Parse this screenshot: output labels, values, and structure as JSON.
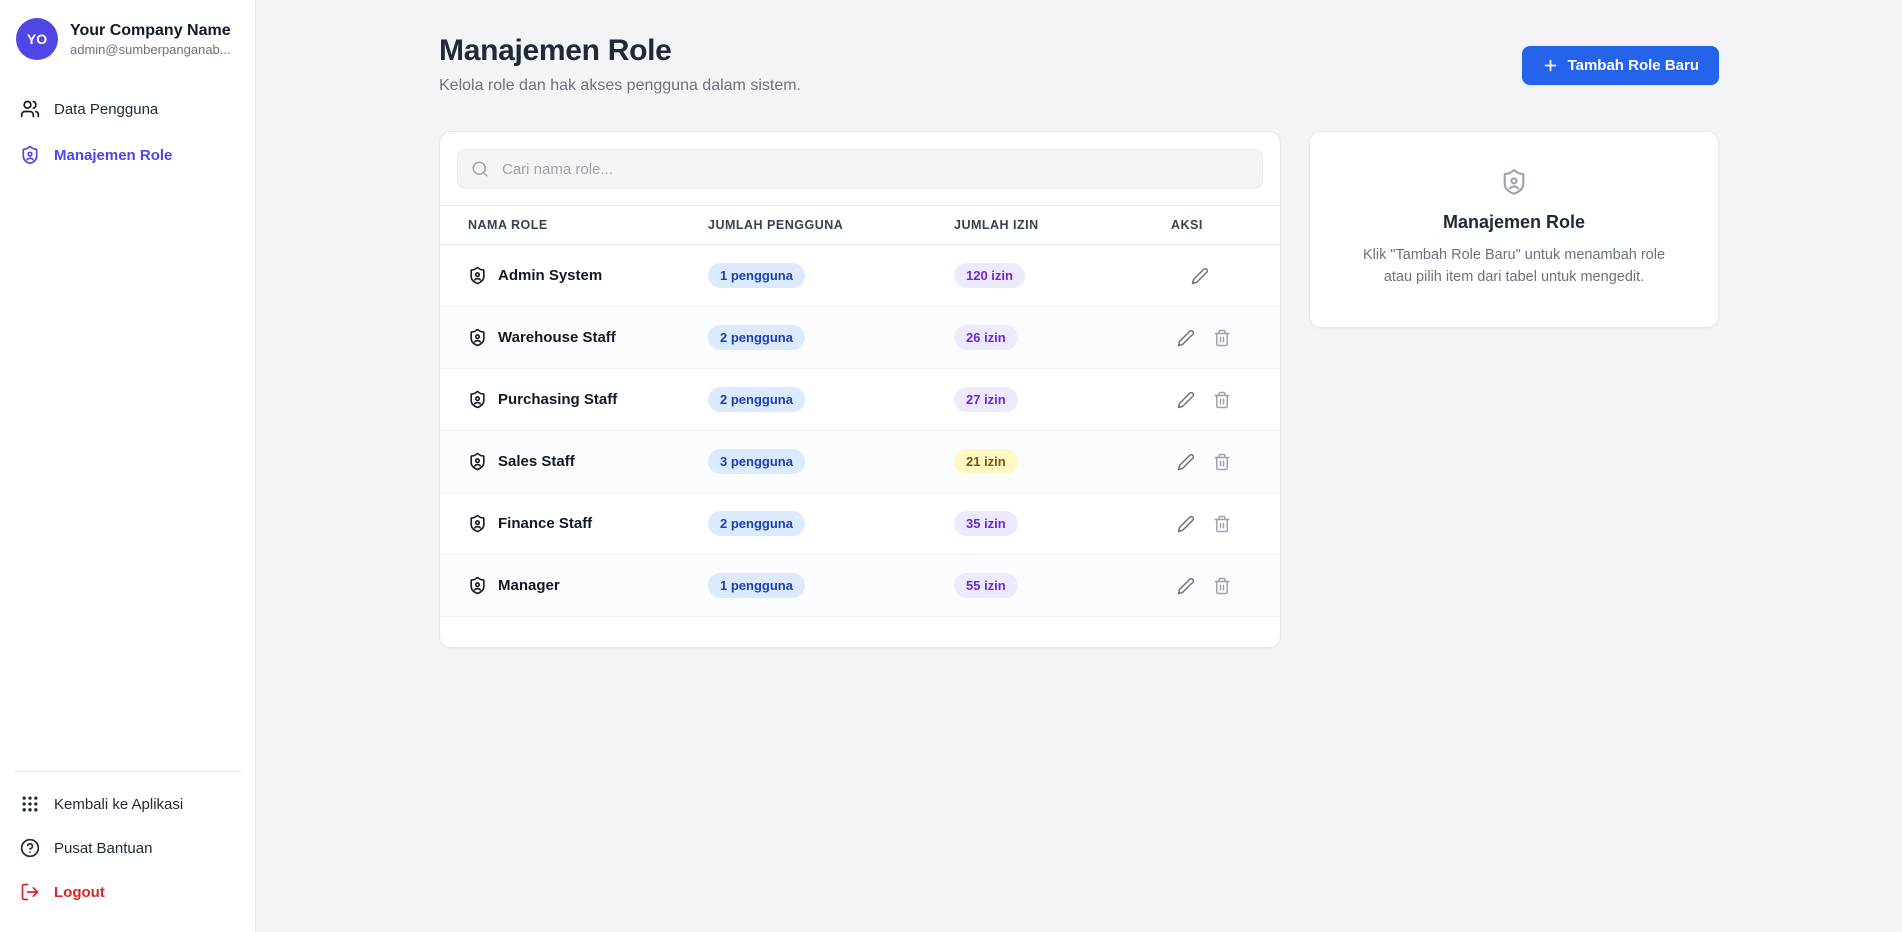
{
  "sidebar": {
    "avatar_initials": "YO",
    "company_name": "Your Company Name",
    "email": "admin@sumberpanganab...",
    "items": [
      {
        "label": "Data Pengguna",
        "icon": "users-icon",
        "active": false
      },
      {
        "label": "Manajemen Role",
        "icon": "shield-user-icon",
        "active": true
      }
    ],
    "footer_items": [
      {
        "label": "Kembali ke Aplikasi",
        "icon": "grid-icon"
      },
      {
        "label": "Pusat Bantuan",
        "icon": "help-circle-icon"
      },
      {
        "label": "Logout",
        "icon": "logout-icon"
      }
    ]
  },
  "header": {
    "title": "Manajemen Role",
    "subtitle": "Kelola role dan hak akses pengguna dalam sistem.",
    "add_button_label": "Tambah Role Baru"
  },
  "search": {
    "placeholder": "Cari nama role..."
  },
  "table": {
    "columns": [
      "NAMA ROLE",
      "JUMLAH PENGGUNA",
      "JUMLAH IZIN",
      "AKSI"
    ],
    "rows": [
      {
        "name": "Admin System",
        "pengguna": "1 pengguna",
        "pengguna_variant": "blue",
        "izin": "120 izin",
        "izin_variant": "purple"
      },
      {
        "name": "Warehouse Staff",
        "pengguna": "2 pengguna",
        "pengguna_variant": "blue",
        "izin": "26 izin",
        "izin_variant": "purple"
      },
      {
        "name": "Purchasing Staff",
        "pengguna": "2 pengguna",
        "pengguna_variant": "blue",
        "izin": "27 izin",
        "izin_variant": "purple"
      },
      {
        "name": "Sales Staff",
        "pengguna": "3 pengguna",
        "pengguna_variant": "blue",
        "izin": "21 izin",
        "izin_variant": "yellow"
      },
      {
        "name": "Finance Staff",
        "pengguna": "2 pengguna",
        "pengguna_variant": "blue",
        "izin": "35 izin",
        "izin_variant": "purple"
      },
      {
        "name": "Manager",
        "pengguna": "1 pengguna",
        "pengguna_variant": "blue",
        "izin": "55 izin",
        "izin_variant": "purple"
      }
    ]
  },
  "info_panel": {
    "title": "Manajemen Role",
    "description": "Klik \"Tambah Role Baru\" untuk menambah role atau pilih item dari tabel untuk mengedit."
  },
  "icons": {
    "avatar": "avatar",
    "nav": [
      "users-icon",
      "shield-user-icon"
    ],
    "footer": [
      "grid-icon",
      "help-circle-icon",
      "logout-icon"
    ],
    "table": [
      "shield-user-icon",
      "pencil-icon",
      "trash-icon"
    ],
    "search": "search-icon",
    "add_button": "plus-icon",
    "info_panel": "shield-user-icon"
  },
  "colors": {
    "accent_button": "#2563eb",
    "sidebar_active": "#4f46e5",
    "avatar_bg": "#4f46e5",
    "logout": "#dc2626",
    "badge_blue_bg": "#dbeafe",
    "badge_blue_text": "#1e40af",
    "badge_purple_bg": "#ede9fe",
    "badge_purple_text": "#6d28d9",
    "badge_yellow_bg": "#fef9c3",
    "badge_yellow_text": "#854d0e",
    "main_background": "#f3f4f6"
  }
}
